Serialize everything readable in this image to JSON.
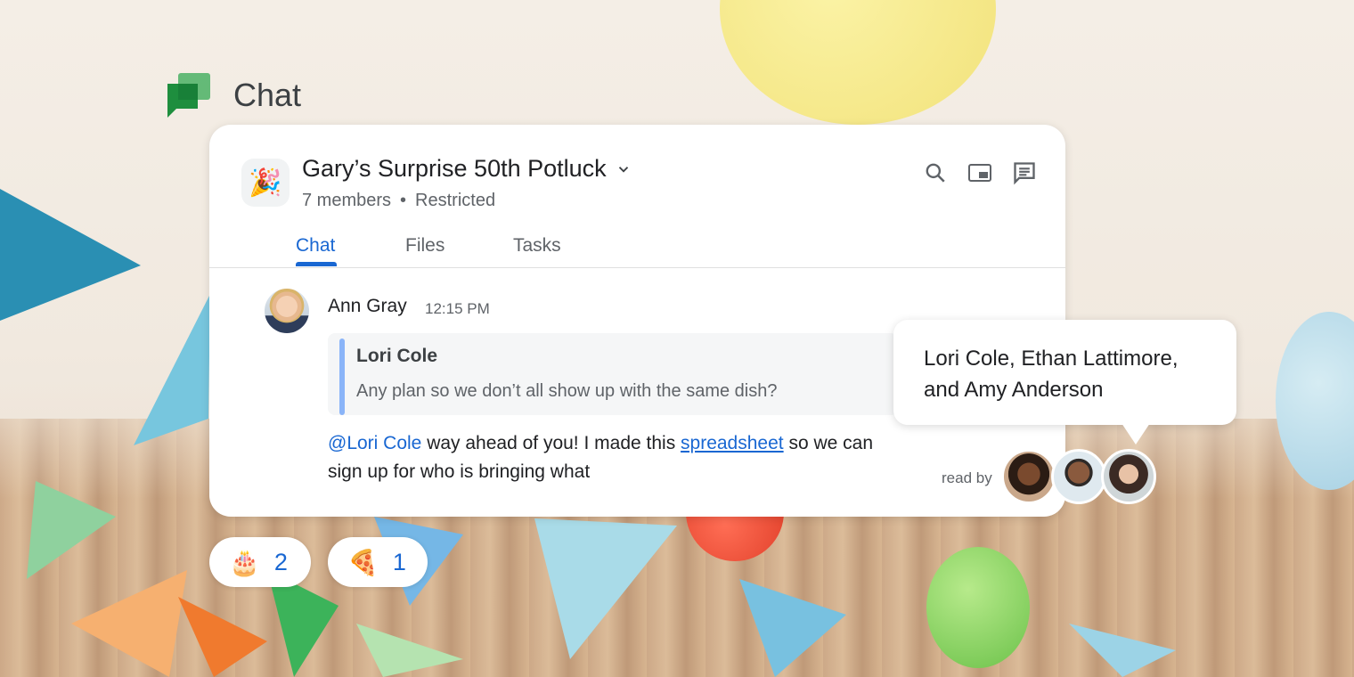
{
  "app": {
    "title": "Chat",
    "logo_icon": "google-chat-icon",
    "brand_color": "#34a853"
  },
  "room": {
    "icon": "party-popper-icon",
    "icon_glyph": "🎉",
    "name": "Gary’s Surprise 50th Potluck",
    "members": "7 members",
    "access": "Restricted"
  },
  "header_icons": [
    "search-icon",
    "picture-in-picture-icon",
    "thread-icon"
  ],
  "tabs": [
    {
      "label": "Chat",
      "active": true
    },
    {
      "label": "Files",
      "active": false
    },
    {
      "label": "Tasks",
      "active": false
    }
  ],
  "message": {
    "sender": "Ann Gray",
    "time": "12:15 PM",
    "quote": {
      "author": "Lori Cole",
      "text": "Any plan so we don’t all show up with the same dish?"
    },
    "mention": "@Lori Cole",
    "text_before_link": " way ahead of you! I made this ",
    "link": "spreadsheet",
    "text_after_link": " so we can sign up for who is bringing what"
  },
  "read_receipt": {
    "label": "read by",
    "tooltip": "Lori Cole, Ethan Lattimore, and Amy Anderson"
  },
  "reactions": [
    {
      "emoji": "🎂",
      "count": "2"
    },
    {
      "emoji": "🍕",
      "count": "1"
    }
  ],
  "colors": {
    "accent": "#1967d2",
    "quote_bar": "#8ab4f8"
  }
}
